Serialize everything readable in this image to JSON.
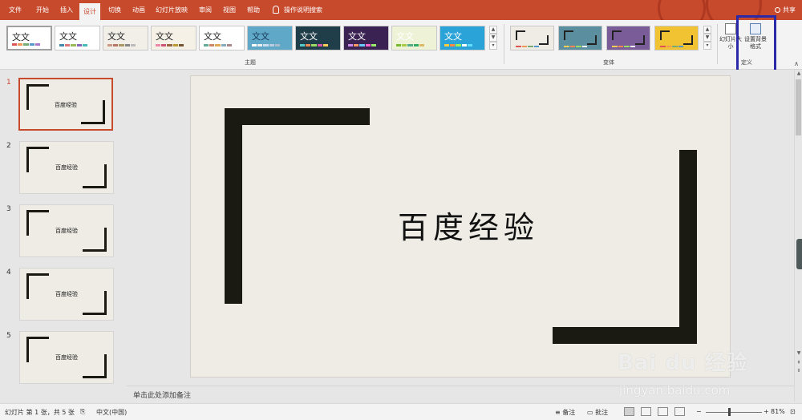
{
  "tabs": [
    {
      "label": "文件"
    },
    {
      "label": "开始"
    },
    {
      "label": "插入"
    },
    {
      "label": "设计"
    },
    {
      "label": "切换"
    },
    {
      "label": "动画"
    },
    {
      "label": "幻灯片放映"
    },
    {
      "label": "审阅"
    },
    {
      "label": "视图"
    },
    {
      "label": "帮助"
    }
  ],
  "active_tab": "设计",
  "tell_me": "操作说明搜索",
  "share": "共享",
  "ribbon": {
    "themes_group_label": "主题",
    "variants_group_label": "变体",
    "customize_group_label": "定义",
    "theme_sample_text": "文文",
    "slide_size_label": "幻灯片大小",
    "format_bg_label": "设置背景格式",
    "themes": [
      {
        "bg": "#ffffff",
        "fg": "#222222",
        "bars": [
          "#d55",
          "#e95",
          "#7a7",
          "#59c",
          "#a7c"
        ]
      },
      {
        "bg": "#ffffff",
        "fg": "#222222",
        "bars": [
          "#48a",
          "#d77",
          "#9b5",
          "#86b",
          "#4bb"
        ]
      },
      {
        "bg": "#f2efe9",
        "fg": "#222222",
        "bars": [
          "#c98",
          "#b76",
          "#a96",
          "#888",
          "#bbb"
        ]
      },
      {
        "bg": "#f6f1e6",
        "fg": "#222222",
        "bars": [
          "#e8a",
          "#c57",
          "#964",
          "#b93",
          "#753"
        ]
      },
      {
        "bg": "#ffffff",
        "fg": "#222222",
        "bars": [
          "#6a9",
          "#c86",
          "#da5",
          "#8ab",
          "#a88"
        ]
      },
      {
        "bg": "#5fa8c7",
        "fg": "#1a3a5a",
        "bars": [
          "#fff",
          "#eee",
          "#cde",
          "#bcd",
          "#abc"
        ]
      },
      {
        "bg": "#1f3e4a",
        "fg": "#ffffff",
        "bars": [
          "#5cc",
          "#e85",
          "#9d6",
          "#d5a",
          "#fc5"
        ]
      },
      {
        "bg": "#3a2253",
        "fg": "#ffffff",
        "bars": [
          "#c8e",
          "#f96",
          "#6cf",
          "#f6c",
          "#9e6"
        ]
      },
      {
        "bg": "#eef3d8",
        "fg": "#ffffff",
        "bars": [
          "#7b3",
          "#ac4",
          "#5a8",
          "#3a6",
          "#db6"
        ]
      },
      {
        "bg": "#2aa3d8",
        "fg": "#ffffff",
        "bars": [
          "#fc4",
          "#f84",
          "#9e5",
          "#fff",
          "#6df"
        ]
      }
    ],
    "variants": [
      {
        "bg": "#eeece5",
        "bars": [
          "#d55",
          "#e95",
          "#7a7",
          "#59c"
        ]
      },
      {
        "bg": "#5b8fa0",
        "bars": [
          "#fc5",
          "#f85",
          "#9d6",
          "#fff"
        ]
      },
      {
        "bg": "#7a5c98",
        "bars": [
          "#fc5",
          "#f85",
          "#9d6",
          "#fff"
        ]
      },
      {
        "bg": "#f1c232",
        "bars": [
          "#d55",
          "#e95",
          "#7a7",
          "#59c"
        ]
      }
    ]
  },
  "slides": [
    {
      "num": "1",
      "title": "百度经验"
    },
    {
      "num": "2",
      "title": "百度经验"
    },
    {
      "num": "3",
      "title": "百度经验"
    },
    {
      "num": "4",
      "title": "百度经验"
    },
    {
      "num": "5",
      "title": "百度经验"
    }
  ],
  "main_slide": {
    "title": "百度经验"
  },
  "notes_placeholder": "单击此处添加备注",
  "status": {
    "slide_info": "幻灯片 第 1 张，共 5 张",
    "language": "中文(中国)",
    "notes_btn": "备注",
    "comments_btn": "批注",
    "zoom": "81%",
    "zoom_fraction": 0.81
  },
  "watermark": {
    "logo": "Bai du 经验",
    "url": "jingyan.baidu.com"
  },
  "colors": {
    "accent": "#c74a2d",
    "highlight": "#2a2aa8",
    "frame": "#1a1a12",
    "slide_bg": "#eeece5"
  }
}
